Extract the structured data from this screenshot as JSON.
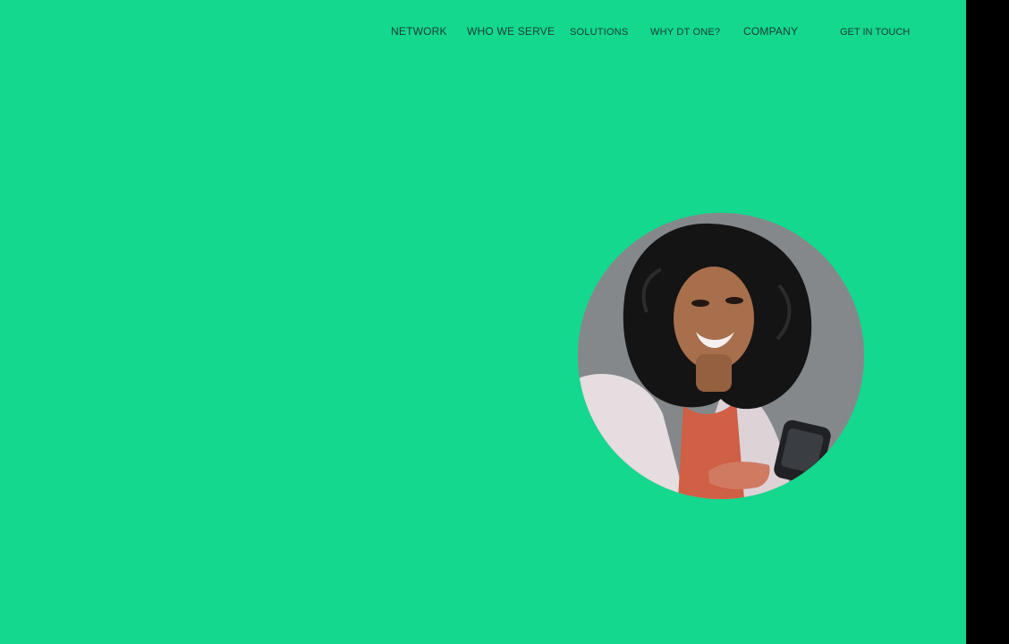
{
  "nav": {
    "items": [
      {
        "label": "NETWORK"
      },
      {
        "label": "WHO WE SERVE"
      },
      {
        "label": "SOLUTIONS"
      },
      {
        "label": "WHY DT ONE?"
      },
      {
        "label": "COMPANY"
      }
    ],
    "cta_label": "GET IN TOUCH"
  },
  "colors": {
    "background": "#13d88e",
    "text": "#173b36",
    "outside": "#000000"
  },
  "hero": {
    "image_alt": "Smiling woman with curly hair holding a phone"
  }
}
